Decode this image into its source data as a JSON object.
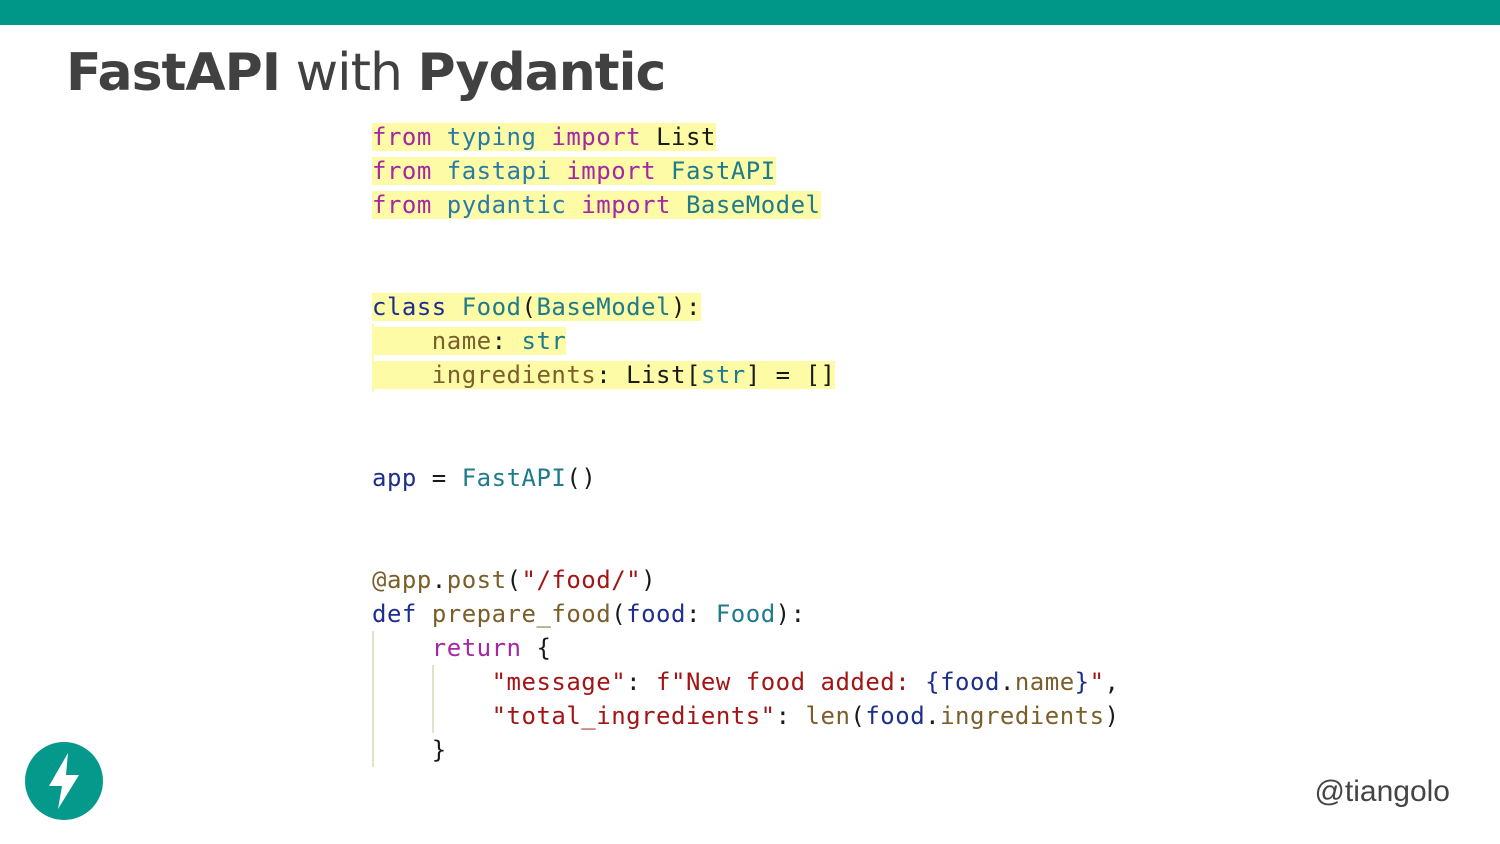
{
  "title": {
    "bold1": "FastAPI",
    "normal": " with ",
    "bold2": "Pydantic"
  },
  "code": {
    "l1": [
      "from",
      " ",
      "typing",
      " ",
      "import",
      " ",
      "List"
    ],
    "l2": [
      "from",
      " ",
      "fastapi",
      " ",
      "import",
      " ",
      "FastAPI"
    ],
    "l3": [
      "from",
      " ",
      "pydantic",
      " ",
      "import",
      " ",
      "BaseModel"
    ],
    "l4": [
      "class",
      " ",
      "Food",
      "(",
      "BaseModel",
      "):"
    ],
    "l5": [
      "    name",
      ": ",
      "str"
    ],
    "l6": [
      "    ingredients",
      ": ",
      "List",
      "[",
      "str",
      "] = []"
    ],
    "l7": [
      "app",
      " = ",
      "FastAPI",
      "()"
    ],
    "l8": [
      "@app",
      ".",
      "post",
      "(",
      "\"/food/\"",
      ")"
    ],
    "l9": [
      "def",
      " ",
      "prepare_food",
      "(",
      "food",
      ": ",
      "Food",
      "):"
    ],
    "l10": [
      "    ",
      "return",
      " {"
    ],
    "l11": [
      "        ",
      "\"message\"",
      ": ",
      "f\"New food added: ",
      "{",
      "food",
      ".",
      "name",
      "}",
      "\"",
      ","
    ],
    "l12": [
      "        ",
      "\"total_ingredients\"",
      ": ",
      "len",
      "(",
      "food",
      ".",
      "ingredients",
      ")"
    ],
    "l13": [
      "    }"
    ]
  },
  "handle": "@tiangolo",
  "logo": {
    "icon": "lightning-bolt-icon",
    "color": "#05998b"
  },
  "accent_color": "#009688"
}
